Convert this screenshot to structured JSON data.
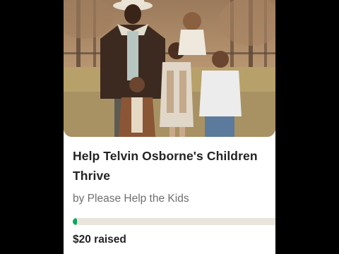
{
  "campaign": {
    "title": "Help Telvin Osborne's Children Thrive",
    "organizer": "by Please Help the Kids",
    "amount_raised": "$20 raised",
    "progress_fraction": 0.02,
    "accent_color": "#02a95c"
  }
}
